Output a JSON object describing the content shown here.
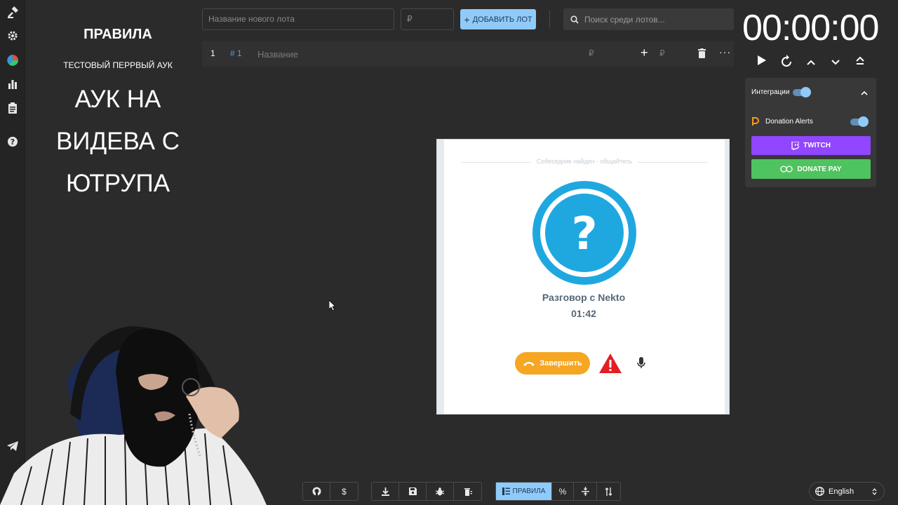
{
  "rules": {
    "title": "ПРАВИЛА",
    "subtitle": "ТЕСТОВЫЙ ПЕРРВЫЙ АУК",
    "line1": "АУК НА",
    "line2": "ВИДЕВА С",
    "line3": "ЮТРУПА"
  },
  "topbar": {
    "lot_name_placeholder": "Название нового лота",
    "lot_price_placeholder": "₽",
    "add_label": "ДОБАВИТЬ ЛОТ",
    "search_placeholder": "Поиск среди лотов..."
  },
  "lot": {
    "index": "1",
    "id": "# 1",
    "name_placeholder": "Название",
    "currency": "₽",
    "add_currency": "₽"
  },
  "timer": {
    "value": "00:00:00"
  },
  "integrations": {
    "label": "Интеграции",
    "donation_alerts": "Donation Alerts",
    "twitch": "TWITCH",
    "donatepay": "DONATE PAY"
  },
  "nekto": {
    "status": "Собеседник найден - общайтесь",
    "title": "Разговор с Nekto",
    "time": "01:42",
    "end_label": "Завершить"
  },
  "toolbar": {
    "currency_btn": "$",
    "percent_btn": "%",
    "rules_label": "ПРАВИЛА"
  },
  "language": {
    "selected": "English"
  },
  "colors": {
    "accent": "#90caf9",
    "twitch": "#9146ff",
    "donatepay": "#4fc35f",
    "nekto_blue": "#1fa8e0",
    "end_orange": "#f5a623",
    "warning_red": "#e31e24"
  }
}
